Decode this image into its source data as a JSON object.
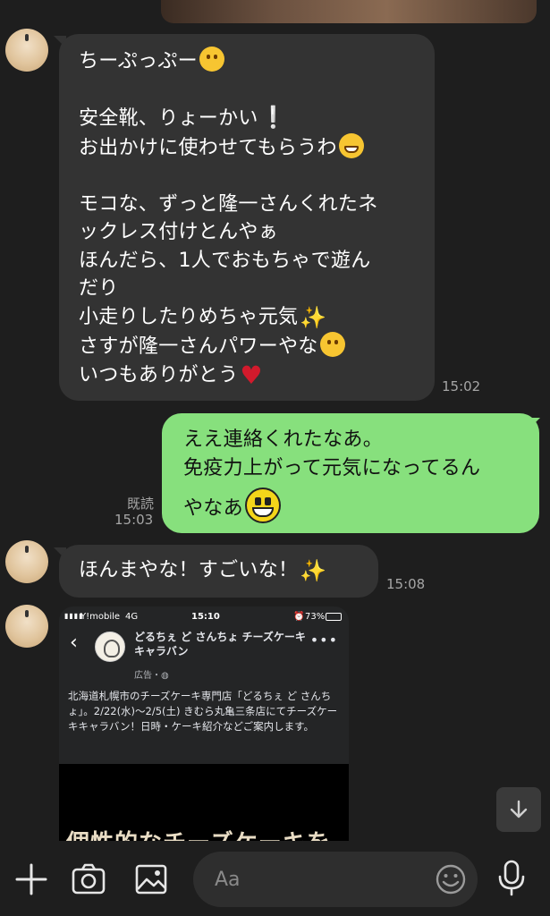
{
  "messages": {
    "m1": {
      "lines": [
        "ちーぷっぷー",
        "",
        "安全靴、りょーかい",
        "お出かけに使わせてもらうわ",
        "",
        "モコな、ずっと隆一さんくれたネ",
        "ックレス付けとんやぁ",
        "ほんだら、1人でおもちゃで遊ん",
        "だり",
        "小走りしたりめちゃ元気",
        "さすが隆一さんパワーやな",
        "いつもありがとう"
      ],
      "time": "15:02"
    },
    "m2": {
      "lines": [
        "ええ連絡くれたなあ。",
        "免疫力上がって元気になってるん",
        "やなあ"
      ],
      "read": "既読",
      "time": "15:03"
    },
    "m3": {
      "text": "ほんまやな！すごいな！",
      "time": "15:08"
    },
    "m4": {
      "status": {
        "carrier": "Y!mobile",
        "network": "4G",
        "clock": "15:10",
        "battery": "73%"
      },
      "page_name": "どるちぇ ど さんちょ チーズケーキキャラバン",
      "ad_label": "広告・",
      "description": "北海道札幌市のチーズケーキ専門店「どるちぇ ど さんちょ」。2/22(水)〜2/5(土) きむら丸亀三条店にてチーズケーキキャラバン！日時・ケーキ紹介などご案内します。",
      "hero_text": "個性的なチーズケーキを"
    }
  },
  "input": {
    "placeholder": "Aa"
  },
  "icons": [
    "plus-icon",
    "camera-icon",
    "image-icon",
    "smiley-icon",
    "microphone-icon",
    "arrow-down-icon"
  ],
  "colors": {
    "background": "#1e1e1e",
    "incoming_bubble": "#333333",
    "outgoing_bubble": "#87e07d"
  }
}
